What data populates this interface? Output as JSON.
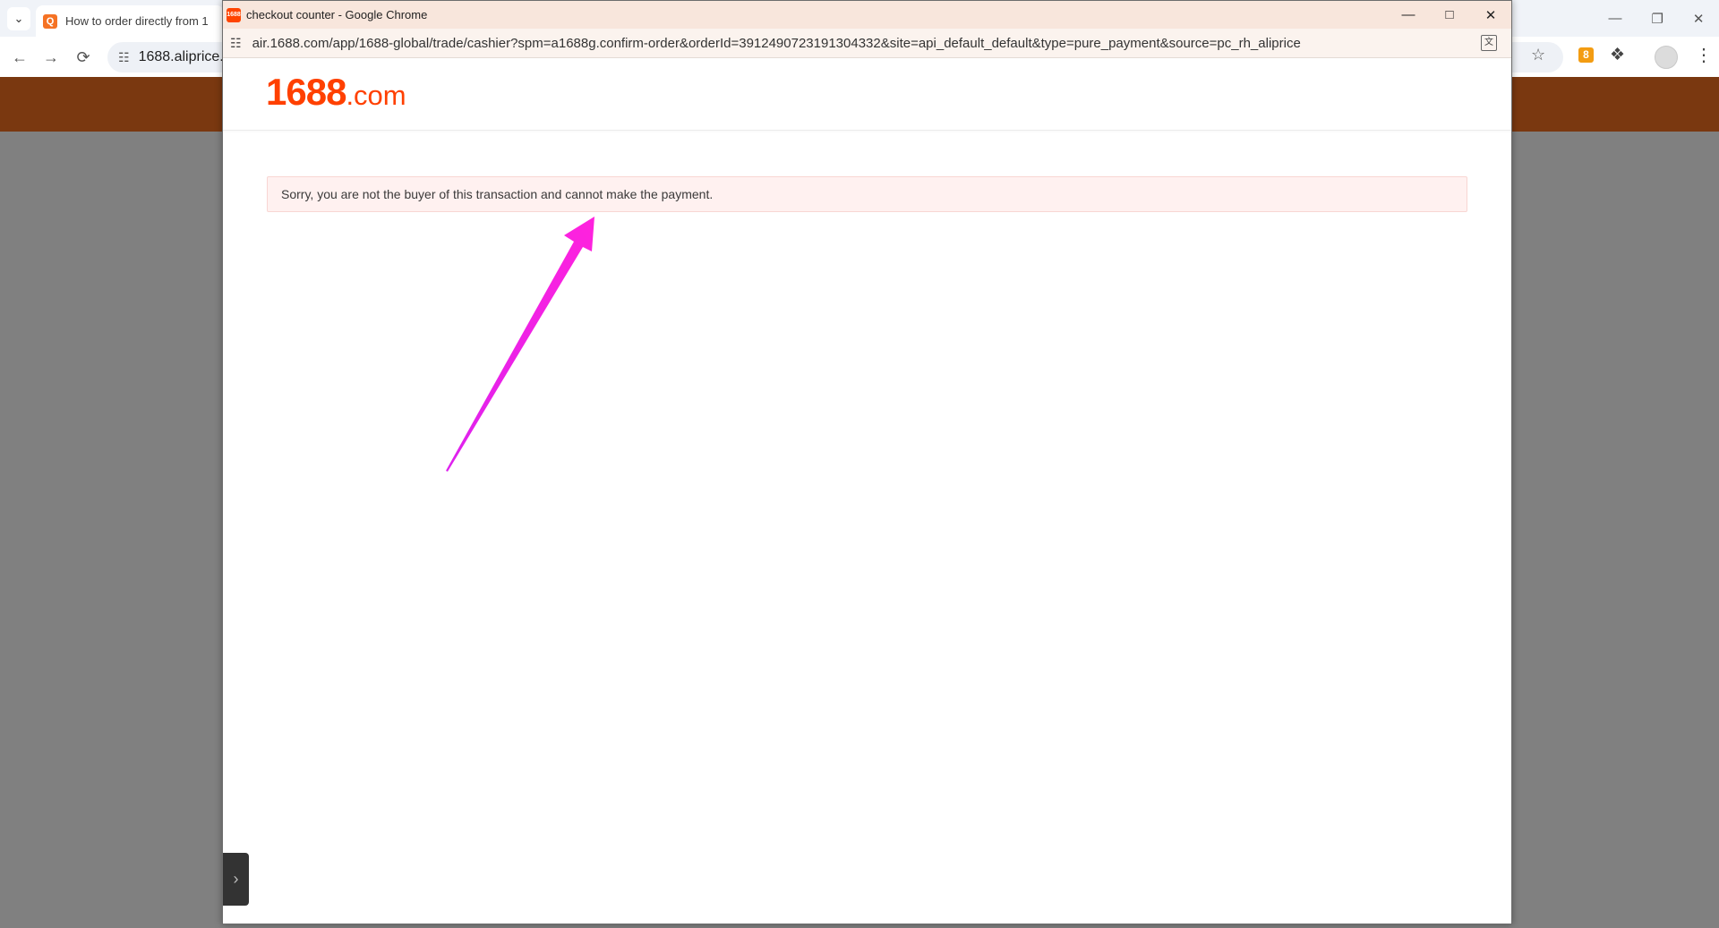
{
  "background_window": {
    "tab": {
      "favicon_glyph": "Q",
      "title": "How to order directly from 1"
    },
    "omnibox_url": "1688.aliprice.c",
    "extension_badge": "8"
  },
  "popup": {
    "favicon_text": "1688",
    "title": "checkout counter - Google Chrome",
    "url": "air.1688.com/app/1688-global/trade/cashier?spm=a1688g.confirm-order&orderId=3912490723191304332&site=api_default_default&type=pure_payment&source=pc_rh_aliprice",
    "logo": {
      "number": "1688",
      "domain": ".com"
    },
    "error_message": "Sorry, you are not the buyer of this transaction and cannot make the payment."
  },
  "colors": {
    "brand": "#ff4000",
    "banner": "#7a3810",
    "annotation_arrow": "#ee22ee",
    "alert_bg": "#fff1f0",
    "alert_border": "#f8d6d3"
  },
  "icons": {
    "tab_search": "chevron-down-icon",
    "back": "arrow-left-icon",
    "forward": "arrow-right-icon",
    "reload": "reload-icon",
    "site_settings": "tune-icon",
    "bookmark": "star-icon",
    "extensions": "puzzle-icon",
    "menu": "kebab-menu-icon",
    "minimize": "minimize-icon",
    "maximize": "maximize-icon",
    "close": "close-icon",
    "translate": "translate-icon",
    "side_toggle": "chevron-right-icon"
  }
}
